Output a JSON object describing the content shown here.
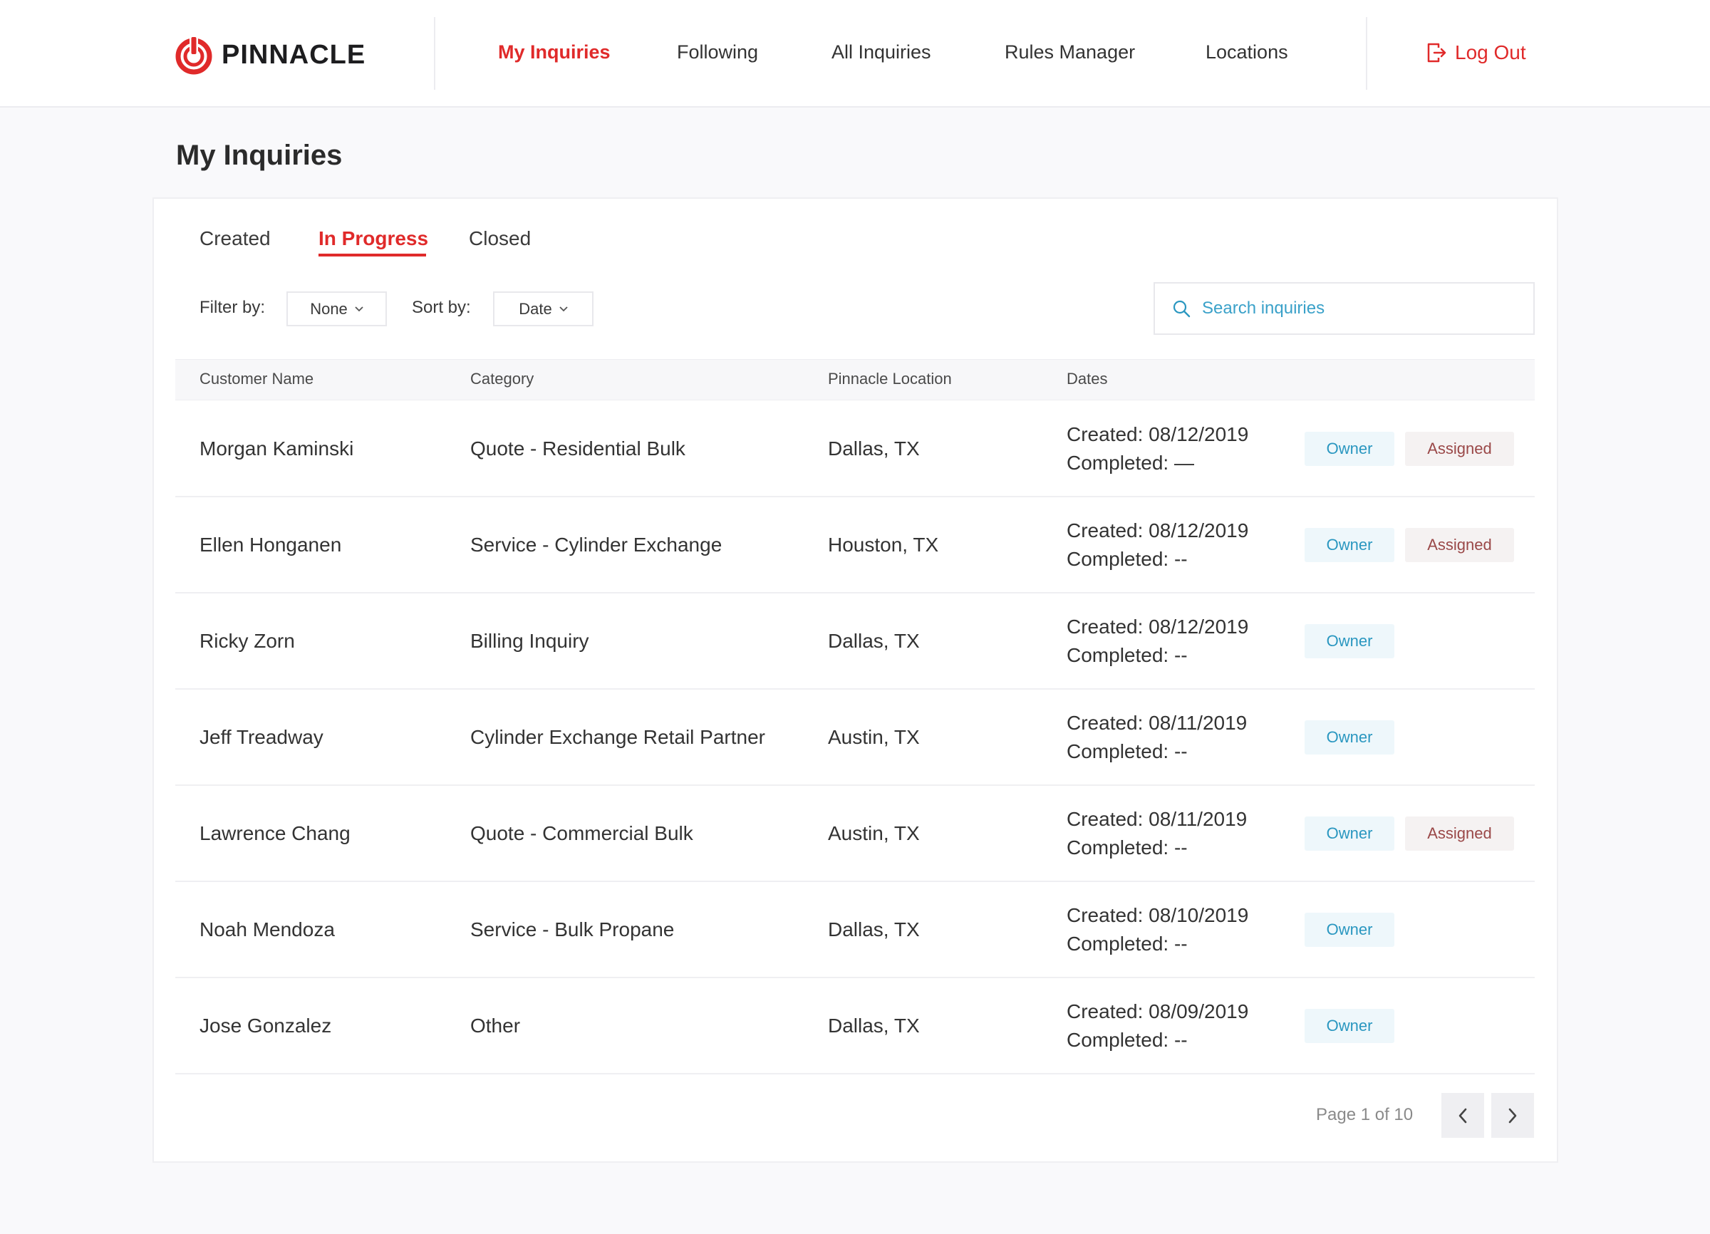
{
  "brand": {
    "name": "PINNACLE"
  },
  "nav": {
    "items": [
      {
        "label": "My Inquiries",
        "active": true
      },
      {
        "label": "Following"
      },
      {
        "label": "All Inquiries"
      },
      {
        "label": "Rules Manager"
      },
      {
        "label": "Locations"
      }
    ],
    "logout_label": "Log Out"
  },
  "page": {
    "title": "My Inquiries"
  },
  "tabs": [
    {
      "label": "Created"
    },
    {
      "label": "In Progress",
      "active": true
    },
    {
      "label": "Closed"
    }
  ],
  "controls": {
    "filter_label": "Filter by:",
    "filter_value": "None",
    "sort_label": "Sort by:",
    "sort_value": "Date",
    "search_placeholder": "Search inquiries"
  },
  "table": {
    "headers": [
      "Customer Name",
      "Category",
      "Pinnacle Location",
      "Dates"
    ],
    "rows": [
      {
        "name": "Morgan Kaminski",
        "category": "Quote - Residential Bulk",
        "location": "Dallas, TX",
        "created": "Created: 08/12/2019",
        "completed": "Completed: —",
        "owner": "Owner",
        "assigned": "Assigned"
      },
      {
        "name": "Ellen Honganen",
        "category": "Service - Cylinder Exchange",
        "location": "Houston, TX",
        "created": "Created: 08/12/2019",
        "completed": "Completed: --",
        "owner": "Owner",
        "assigned": "Assigned"
      },
      {
        "name": "Ricky Zorn",
        "category": "Billing Inquiry",
        "location": "Dallas, TX",
        "created": "Created: 08/12/2019",
        "completed": "Completed: --",
        "owner": "Owner"
      },
      {
        "name": "Jeff Treadway",
        "category": "Cylinder Exchange Retail Partner",
        "location": "Austin, TX",
        "created": "Created: 08/11/2019",
        "completed": "Completed: --",
        "owner": "Owner"
      },
      {
        "name": "Lawrence Chang",
        "category": "Quote - Commercial Bulk",
        "location": "Austin, TX",
        "created": "Created: 08/11/2019",
        "completed": "Completed: --",
        "owner": "Owner",
        "assigned": "Assigned"
      },
      {
        "name": "Noah Mendoza",
        "category": "Service - Bulk Propane",
        "location": "Dallas, TX",
        "created": "Created: 08/10/2019",
        "completed": "Completed: --",
        "owner": "Owner"
      },
      {
        "name": "Jose Gonzalez",
        "category": "Other",
        "location": "Dallas, TX",
        "created": "Created: 08/09/2019",
        "completed": "Completed: --",
        "owner": "Owner"
      }
    ]
  },
  "pagination": {
    "label": "Page 1 of 10"
  },
  "icons": {
    "logo": "power-icon",
    "logout": "logout-icon",
    "search": "search-icon",
    "prev": "chevron-left-icon",
    "next": "chevron-right-icon",
    "dropdown": "chevron-down-icon"
  },
  "colors": {
    "accent": "#e02a2a",
    "owner_text": "#2a97c0",
    "owner_bg": "#eef7fb",
    "assigned_text": "#9a4848",
    "assigned_bg": "#f5f2f2"
  }
}
